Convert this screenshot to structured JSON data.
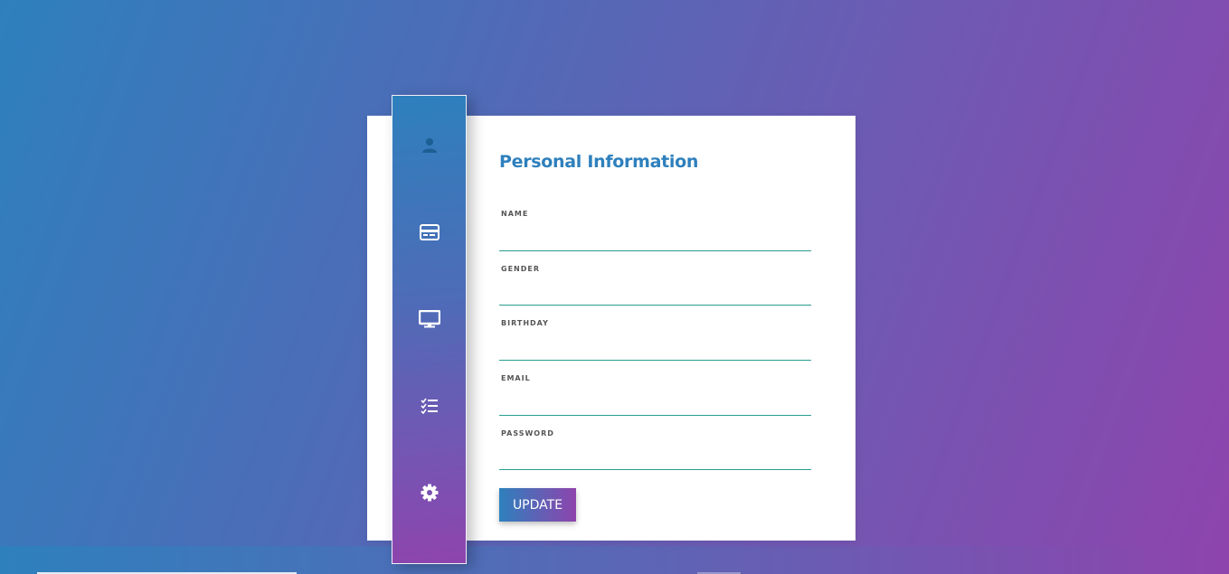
{
  "page": {
    "title": "Personal Information",
    "update_label": "UPDATE"
  },
  "sidebar": {
    "items": [
      {
        "icon": "user-icon",
        "active": true
      },
      {
        "icon": "credit-card-icon",
        "active": false
      },
      {
        "icon": "monitor-icon",
        "active": false
      },
      {
        "icon": "checklist-icon",
        "active": false
      },
      {
        "icon": "gear-icon",
        "active": false
      }
    ]
  },
  "form": {
    "fields": [
      {
        "label": "NAME",
        "value": ""
      },
      {
        "label": "GENDER",
        "value": ""
      },
      {
        "label": "BIRTHDAY",
        "value": ""
      },
      {
        "label": "EMAIL",
        "value": ""
      },
      {
        "label": "PASSWORD",
        "value": ""
      }
    ]
  },
  "colors": {
    "accent": "#2e80bd",
    "gradient_end": "#8e44ad",
    "underline": "#2a9d8f",
    "active_icon": "#1d5f93"
  }
}
